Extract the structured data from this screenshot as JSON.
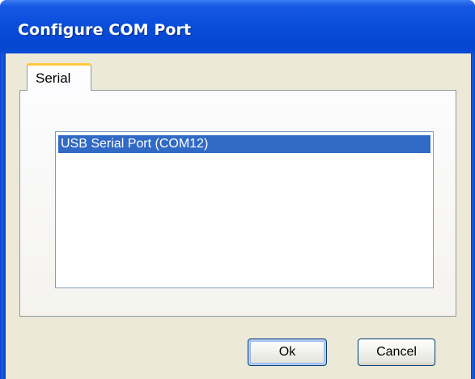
{
  "window": {
    "title": "Configure COM Port"
  },
  "tabs": [
    {
      "label": "Serial",
      "selected": true
    }
  ],
  "port_list": {
    "items": [
      {
        "label": "USB Serial Port (COM12)",
        "selected": true
      }
    ]
  },
  "buttons": {
    "ok_label": "Ok",
    "cancel_label": "Cancel"
  },
  "colors": {
    "titlebar": "#0a4edb",
    "dialog_background": "#ece9d8",
    "selection": "#316ac5",
    "tab_highlight": "#ffc83c"
  }
}
